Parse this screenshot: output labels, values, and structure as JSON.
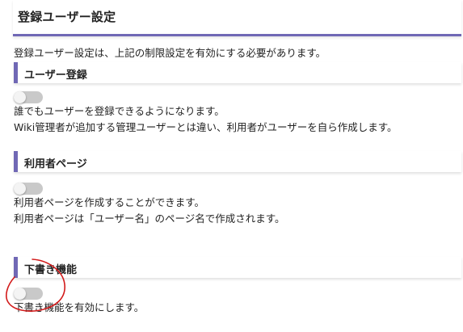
{
  "page": {
    "title": "登録ユーザー設定",
    "note": "登録ユーザー設定は、上記の制限設定を有効にする必要があります。"
  },
  "sections": [
    {
      "header": "ユーザー登録",
      "toggle_on": false,
      "description": [
        "誰でもユーザーを登録できるようになります。",
        "Wiki管理者が追加する管理ユーザーとは違い、利用者がユーザーを自ら作成します。"
      ]
    },
    {
      "header": "利用者ページ",
      "toggle_on": false,
      "description": [
        "利用者ページを作成することができます。",
        "利用者ページは「ユーザー名」のページ名で作成されます。"
      ]
    },
    {
      "header": "下書き機能",
      "toggle_on": false,
      "description": [
        "下書き機能を有効にします。"
      ]
    }
  ],
  "colors": {
    "accent": "#7068b5",
    "toggle_off_track": "#c9c9c9",
    "annotation_circle": "#d21a1a"
  }
}
